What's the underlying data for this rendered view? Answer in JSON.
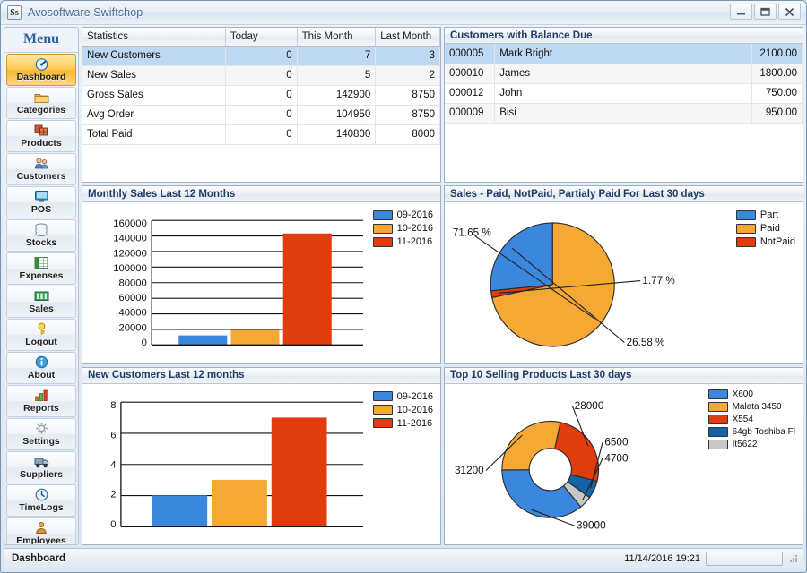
{
  "window": {
    "app_icon": "Ss",
    "title": "Avosoftware Swiftshop",
    "minimize": "–",
    "maximize": "❐",
    "close": "✕"
  },
  "sidebar": {
    "title": "Menu",
    "items": [
      {
        "label": "Dashboard",
        "icon": "dashboard-gauge-icon",
        "active": true
      },
      {
        "label": "Categories",
        "icon": "folder-icon",
        "active": false
      },
      {
        "label": "Products",
        "icon": "boxes-icon",
        "active": false
      },
      {
        "label": "Customers",
        "icon": "people-icon",
        "active": false
      },
      {
        "label": "POS",
        "icon": "monitor-icon",
        "active": false
      },
      {
        "label": "Stocks",
        "icon": "database-icon",
        "active": false
      },
      {
        "label": "Expenses",
        "icon": "spreadsheet-icon",
        "active": false
      },
      {
        "label": "Sales",
        "icon": "money-icon",
        "active": false
      },
      {
        "label": "Logout",
        "icon": "key-icon",
        "active": false
      },
      {
        "label": "About",
        "icon": "info-icon",
        "active": false
      },
      {
        "label": "Reports",
        "icon": "barchart-icon",
        "active": false
      },
      {
        "label": "Settings",
        "icon": "gear-icon",
        "active": false
      },
      {
        "label": "Suppliers",
        "icon": "truck-icon",
        "active": false
      },
      {
        "label": "TimeLogs",
        "icon": "clock-icon",
        "active": false
      },
      {
        "label": "Employees",
        "icon": "badge-person-icon",
        "active": false
      }
    ]
  },
  "statistics": {
    "columns": [
      "Statistics",
      "Today",
      "This Month",
      "Last Month"
    ],
    "rows": [
      {
        "name": "New Customers",
        "today": "0",
        "this_month": "7",
        "last_month": "3",
        "selected": true
      },
      {
        "name": "New Sales",
        "today": "0",
        "this_month": "5",
        "last_month": "2",
        "selected": false
      },
      {
        "name": "Gross Sales",
        "today": "0",
        "this_month": "142900",
        "last_month": "8750",
        "selected": false
      },
      {
        "name": "Avg Order",
        "today": "0",
        "this_month": "104950",
        "last_month": "8750",
        "selected": false
      },
      {
        "name": "Total Paid",
        "today": "0",
        "this_month": "140800",
        "last_month": "8000",
        "selected": false
      }
    ]
  },
  "balance_due": {
    "title": "Customers with Balance Due",
    "rows": [
      {
        "id": "000005",
        "name": "Mark Bright",
        "amount": "2100.00",
        "selected": true
      },
      {
        "id": "000010",
        "name": "James",
        "amount": "1800.00",
        "selected": false
      },
      {
        "id": "000012",
        "name": "John",
        "amount": "750.00",
        "selected": false
      },
      {
        "id": "000009",
        "name": "Bisi",
        "amount": "950.00",
        "selected": false
      }
    ]
  },
  "panels": {
    "monthly_sales": "Monthly Sales Last 12 Months",
    "sales_paid": "Sales - Paid, NotPaid, Partialy Paid For Last 30 days",
    "new_customers": "New Customers Last 12 months",
    "top_products": "Top 10 Selling Products Last 30 days"
  },
  "colors": {
    "blue": "#3b87dd",
    "orange": "#f5a934",
    "red": "#e03c0e",
    "darkblue": "#1464a5",
    "gray": "#c8c8c8",
    "header_text": "#1f3d66",
    "accent": "#2c5f96",
    "highlight": "#f9b833"
  },
  "statusbar": {
    "text": "Dashboard",
    "datetime": "11/14/2016 19:21"
  },
  "chart_data": [
    {
      "id": "monthly-sales",
      "type": "bar",
      "title": "Monthly Sales Last 12 Months",
      "categories": [
        "09-2016",
        "10-2016",
        "11-2016"
      ],
      "values": [
        12000,
        19000,
        143000
      ],
      "colors": [
        "#3b87dd",
        "#f5a934",
        "#e03c0e"
      ],
      "ylim": [
        0,
        160000
      ],
      "yticks": [
        0,
        20000,
        40000,
        60000,
        80000,
        100000,
        120000,
        140000,
        160000
      ],
      "ytick_labels": [
        "0",
        "20000",
        "40000",
        "60000",
        "80000",
        "100000",
        "120000",
        "140000",
        "160000"
      ],
      "xlabel": "",
      "ylabel": "",
      "grid": true,
      "legend": [
        "09-2016",
        "10-2016",
        "11-2016"
      ],
      "legend_position": "right"
    },
    {
      "id": "sales-paid-status",
      "type": "pie",
      "title": "Sales - Paid, NotPaid, Partialy Paid For Last 30 days",
      "labels": [
        "Part",
        "Paid",
        "NotPaid"
      ],
      "values": [
        26.58,
        71.65,
        1.77
      ],
      "value_labels": [
        "26.58 %",
        "71.65 %",
        "1.77 %"
      ],
      "colors": [
        "#3b87dd",
        "#f5a934",
        "#e03c0e"
      ],
      "legend": [
        "Part",
        "Paid",
        "NotPaid"
      ],
      "legend_position": "right"
    },
    {
      "id": "new-customers",
      "type": "bar",
      "title": "New Customers Last 12 months",
      "categories": [
        "09-2016",
        "10-2016",
        "11-2016"
      ],
      "values": [
        2,
        3,
        7
      ],
      "colors": [
        "#3b87dd",
        "#f5a934",
        "#e03c0e"
      ],
      "ylim": [
        0,
        8
      ],
      "yticks": [
        0,
        2,
        4,
        6,
        8
      ],
      "ytick_labels": [
        "0",
        "2",
        "4",
        "6",
        "8"
      ],
      "xlabel": "",
      "ylabel": "",
      "grid": true,
      "legend": [
        "09-2016",
        "10-2016",
        "11-2016"
      ],
      "legend_position": "right"
    },
    {
      "id": "top-products",
      "type": "pie",
      "title": "Top 10 Selling Products Last 30 days",
      "donut": true,
      "labels": [
        "X600",
        "Malata 3450",
        "X554",
        "64gb Toshiba Fl",
        "It5622"
      ],
      "values": [
        39000,
        31200,
        28000,
        6500,
        4700
      ],
      "value_labels": [
        "39000",
        "31200",
        "28000",
        "6500",
        "4700"
      ],
      "colors": [
        "#3b87dd",
        "#f5a934",
        "#e03c0e",
        "#1464a5",
        "#c8c8c8"
      ],
      "legend": [
        "X600",
        "Malata 3450",
        "X554",
        "64gb Toshiba Fl",
        "It5622"
      ],
      "legend_position": "right"
    }
  ]
}
